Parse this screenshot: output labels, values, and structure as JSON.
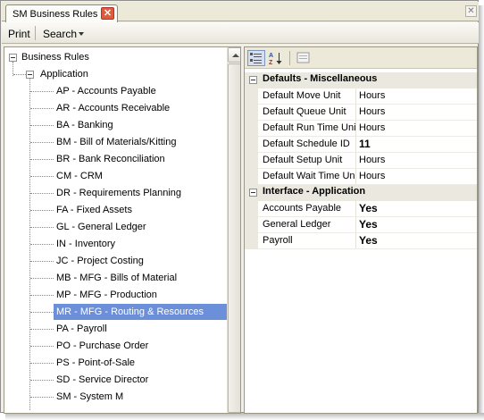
{
  "window": {
    "tab_title": "SM Business Rules",
    "tab_close_glyph": "✕",
    "window_close_glyph": "✕"
  },
  "menu": {
    "print_label": "Print",
    "search_label": "Search"
  },
  "tree": {
    "root_label": "Business Rules",
    "group_label": "Application",
    "items": [
      {
        "label": "AP - Accounts Payable"
      },
      {
        "label": "AR - Accounts Receivable"
      },
      {
        "label": "BA - Banking"
      },
      {
        "label": "BM - Bill of Materials/Kitting"
      },
      {
        "label": "BR - Bank Reconciliation"
      },
      {
        "label": "CM - CRM"
      },
      {
        "label": "DR - Requirements Planning"
      },
      {
        "label": "FA - Fixed Assets"
      },
      {
        "label": "GL - General Ledger"
      },
      {
        "label": "IN - Inventory"
      },
      {
        "label": "JC - Project Costing"
      },
      {
        "label": "MB - MFG - Bills of Material"
      },
      {
        "label": "MP - MFG - Production"
      },
      {
        "label": "MR - MFG - Routing & Resources",
        "selected": true
      },
      {
        "label": "PA - Payroll"
      },
      {
        "label": "PO - Purchase Order"
      },
      {
        "label": "PS - Point-of-Sale"
      },
      {
        "label": "SD - Service Director"
      },
      {
        "label": "SM - System M"
      }
    ]
  },
  "properties": {
    "toolbar": {
      "categorized_icon": "categorized-icon",
      "alphabetical_icon": "sort-az-icon",
      "pages_icon": "property-pages-icon"
    },
    "categories": [
      {
        "label": "Defaults - Miscellaneous",
        "rows": [
          {
            "name": "Default Move Unit",
            "value": "Hours",
            "bold": false
          },
          {
            "name": "Default Queue Unit",
            "value": "Hours",
            "bold": false
          },
          {
            "name": "Default Run Time Unit",
            "value": "Hours",
            "bold": false
          },
          {
            "name": "Default Schedule ID",
            "value": "11",
            "bold": true
          },
          {
            "name": "Default Setup Unit",
            "value": "Hours",
            "bold": false
          },
          {
            "name": "Default Wait Time Unit",
            "value": "Hours",
            "bold": false
          }
        ]
      },
      {
        "label": "Interface - Application",
        "rows": [
          {
            "name": "Accounts Payable",
            "value": "Yes",
            "bold": true
          },
          {
            "name": "General Ledger",
            "value": "Yes",
            "bold": true
          },
          {
            "name": "Payroll",
            "value": "Yes",
            "bold": true
          }
        ]
      }
    ]
  }
}
